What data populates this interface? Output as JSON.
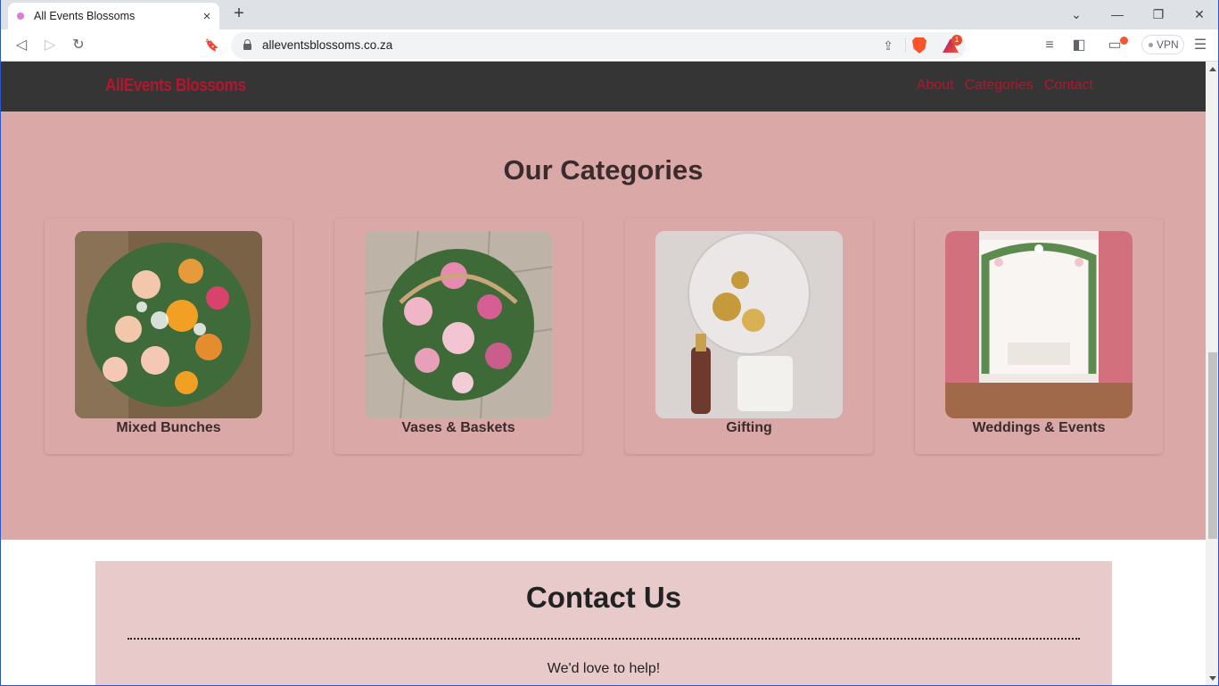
{
  "browser": {
    "tab_title": "All Events Blossoms",
    "url": "alleventsblossoms.co.za",
    "rewards_badge": "1",
    "vpn_label": "VPN",
    "icons": {
      "close": "×",
      "new_tab": "+",
      "tab_search": "⌄",
      "minimize": "—",
      "restore": "❐",
      "window_close": "✕",
      "back": "◁",
      "forward": "▷",
      "reload": "↻",
      "bookmark": "🔖",
      "share": "⇪",
      "playlist": "≡",
      "sidebar": "◧",
      "wallet": "▭",
      "menu": "☰"
    }
  },
  "site": {
    "brand": "AllEvents Blossoms",
    "nav": [
      "About",
      "Categories",
      "Contact"
    ],
    "categories": {
      "heading": "Our Categories",
      "items": [
        {
          "label": "Mixed Bunches"
        },
        {
          "label": "Vases & Baskets"
        },
        {
          "label": "Gifting"
        },
        {
          "label": "Weddings & Events"
        }
      ]
    },
    "contact": {
      "title": "Contact Us",
      "subtitle": "We'd love to help!"
    }
  },
  "colors": {
    "brand_red": "#b3162e",
    "navbar_bg": "#353535",
    "categories_bg": "#dba8a8",
    "contact_bg": "#e8cacb"
  }
}
